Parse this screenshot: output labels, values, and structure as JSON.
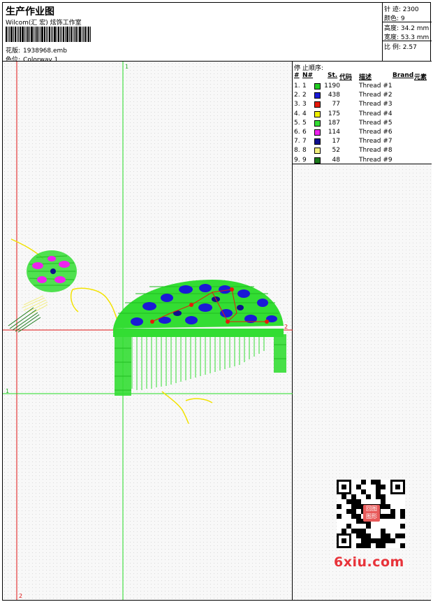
{
  "header": {
    "title": "生产作业图",
    "studio": "Wilcom(汇 宏) 炫饰工作室",
    "filename_label": "花版:",
    "filename": "1938968.emb",
    "colorway_label": "色位:",
    "colorway": "Colorway 1"
  },
  "stats": {
    "stitches": "针 迹: 2300",
    "colors": "颜色: 9",
    "height": "高度: 34.2 mm",
    "width": "宽度: 53.3 mm",
    "ratio": "比 例: 2.57"
  },
  "table": {
    "title": "停 止顺序:",
    "headers": [
      "#",
      "N#",
      "St.",
      "代码",
      "描述",
      "Brand",
      "元素"
    ],
    "rows": [
      {
        "idx": "1.",
        "n": "1",
        "color": "#22cc22",
        "st": "1190",
        "desc": "Thread #1"
      },
      {
        "idx": "2.",
        "n": "2",
        "color": "#1a1ad6",
        "st": "438",
        "desc": "Thread #2"
      },
      {
        "idx": "3.",
        "n": "3",
        "color": "#e61a0a",
        "st": "77",
        "desc": "Thread #3"
      },
      {
        "idx": "4.",
        "n": "4",
        "color": "#f0f000",
        "st": "175",
        "desc": "Thread #4"
      },
      {
        "idx": "5.",
        "n": "5",
        "color": "#33dd33",
        "st": "187",
        "desc": "Thread #5"
      },
      {
        "idx": "6.",
        "n": "6",
        "color": "#ee22ee",
        "st": "114",
        "desc": "Thread #6"
      },
      {
        "idx": "7.",
        "n": "7",
        "color": "#10108c",
        "st": "17",
        "desc": "Thread #7"
      },
      {
        "idx": "8.",
        "n": "8",
        "color": "#f2f07a",
        "st": "52",
        "desc": "Thread #8"
      },
      {
        "idx": "9.",
        "n": "9",
        "color": "#1a7a1a",
        "st": "48",
        "desc": "Thread #9"
      }
    ]
  },
  "guides": {
    "v_green": "1",
    "v_red": "2",
    "h_green": "1",
    "h_red": "2"
  },
  "watermark": {
    "text": "6xiu.com",
    "seal_top": "回图",
    "seal_bottom": "图形"
  }
}
